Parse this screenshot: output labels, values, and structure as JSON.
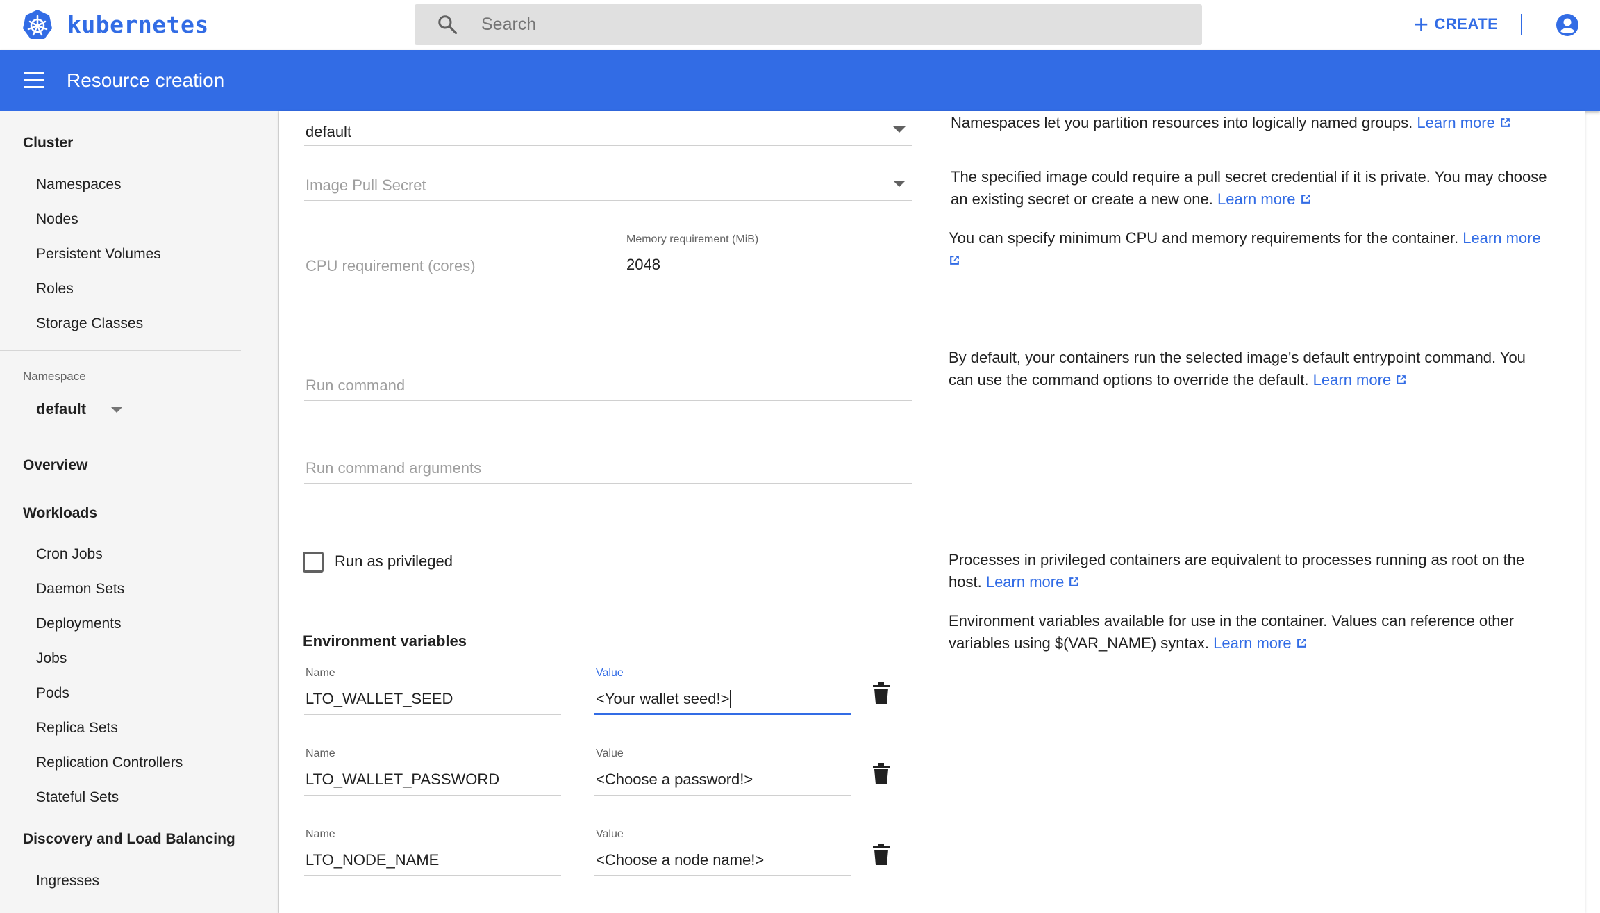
{
  "topbar": {
    "brand": "kubernetes",
    "search_placeholder": "Search",
    "create_label": "CREATE"
  },
  "header": {
    "title": "Resource creation"
  },
  "sidebar": {
    "cluster": {
      "label": "Cluster",
      "items": [
        "Namespaces",
        "Nodes",
        "Persistent Volumes",
        "Roles",
        "Storage Classes"
      ]
    },
    "namespace": {
      "label": "Namespace",
      "selected": "default"
    },
    "overview": "Overview",
    "workloads": {
      "label": "Workloads",
      "items": [
        "Cron Jobs",
        "Daemon Sets",
        "Deployments",
        "Jobs",
        "Pods",
        "Replica Sets",
        "Replication Controllers",
        "Stateful Sets"
      ]
    },
    "discovery": {
      "label": "Discovery and Load Balancing",
      "items": [
        "Ingresses"
      ]
    }
  },
  "form": {
    "namespace_value": "default",
    "image_pull_secret_placeholder": "Image Pull Secret",
    "cpu_placeholder": "CPU requirement (cores)",
    "memory_label": "Memory requirement (MiB)",
    "memory_value": "2048",
    "run_command_placeholder": "Run command",
    "run_command_args_placeholder": "Run command arguments",
    "privileged_label": "Run as privileged",
    "env_heading": "Environment variables",
    "env": [
      {
        "name_label": "Name",
        "name": "LTO_WALLET_SEED",
        "value_label": "Value",
        "value": "<Your wallet seed!>"
      },
      {
        "name_label": "Name",
        "name": "LTO_WALLET_PASSWORD",
        "value_label": "Value",
        "value": "<Choose a password!>"
      },
      {
        "name_label": "Name",
        "name": "LTO_NODE_NAME",
        "value_label": "Value",
        "value": "<Choose a node name!>"
      }
    ]
  },
  "help": {
    "learn_more": "Learn more",
    "namespace": "Namespaces let you partition resources into logically named groups.",
    "pull_secret_1": "The specified image could require a pull secret credential if it is private. You may choose",
    "pull_secret_2": "an existing secret or create a new one.",
    "resources": "You can specify minimum CPU and memory requirements for the container.",
    "command_1": "By default, your containers run the selected image's default entrypoint command. You",
    "command_2": "can use the command options to override the default.",
    "privileged_1": "Processes in privileged containers are equivalent to processes running as root on the",
    "privileged_2": "host.",
    "env_1": "Environment variables available for use in the container. Values can reference other",
    "env_2": "variables using $(VAR_NAME) syntax."
  },
  "colors": {
    "brand_blue": "#326ce5",
    "sidebar_bg": "#f5f5f5",
    "search_bg": "#e0e0e0"
  }
}
